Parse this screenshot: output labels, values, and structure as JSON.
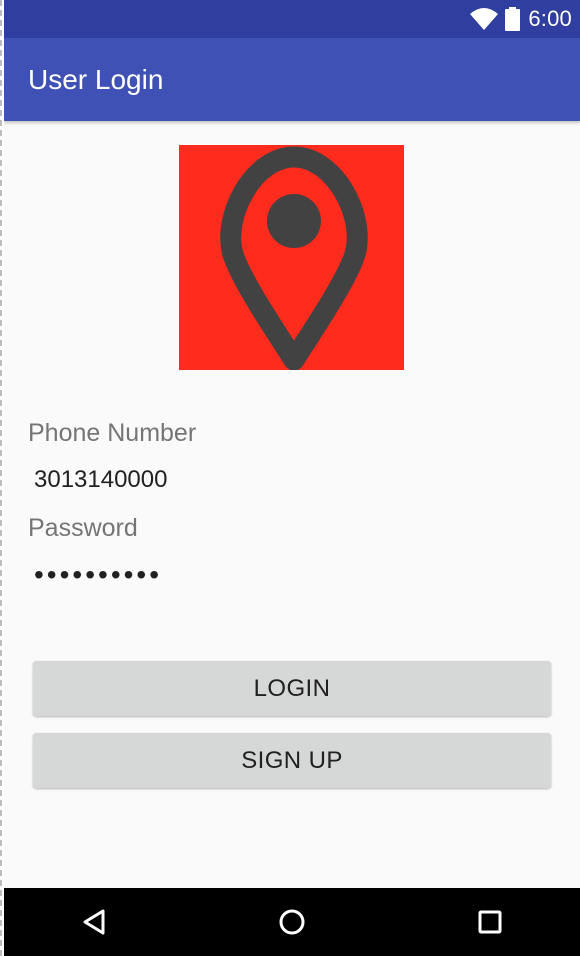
{
  "status_bar": {
    "time": "6:00",
    "icons": [
      "wifi-icon",
      "battery-icon"
    ]
  },
  "app_bar": {
    "title": "User Login"
  },
  "logo": {
    "icon": "location-pin-icon",
    "background_color": "#ff2b1d",
    "pin_color": "#424242"
  },
  "form": {
    "phone": {
      "label": "Phone Number",
      "value": "3013140000"
    },
    "password": {
      "label": "Password",
      "value": "••••••••••"
    }
  },
  "buttons": {
    "login": "LOGIN",
    "signup": "SIGN UP"
  },
  "nav_bar": {
    "icons": [
      "back-icon",
      "home-icon",
      "recents-icon"
    ]
  },
  "colors": {
    "primary": "#3f51b5",
    "primary_dark": "#303f9f",
    "button": "#d6d7d7"
  }
}
